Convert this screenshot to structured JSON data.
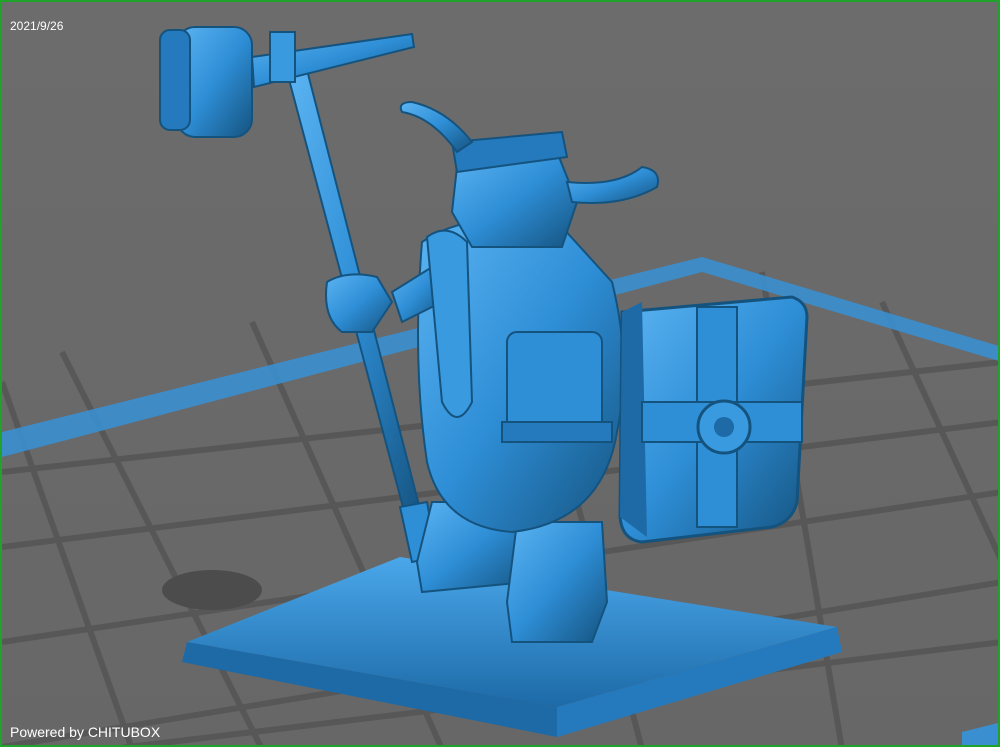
{
  "header": {
    "date": "2021/9/26"
  },
  "footer": {
    "powered_by": "Powered by CHITUBOX"
  },
  "colors": {
    "background": "#6b6b6b",
    "grid_line": "#555555",
    "model": "#2e8ed6",
    "model_highlight": "#5cb4f2",
    "model_shadow": "#15537f",
    "frame": "#1fa32a"
  },
  "model": {
    "name_icon": "dwarf-warrior-model"
  }
}
